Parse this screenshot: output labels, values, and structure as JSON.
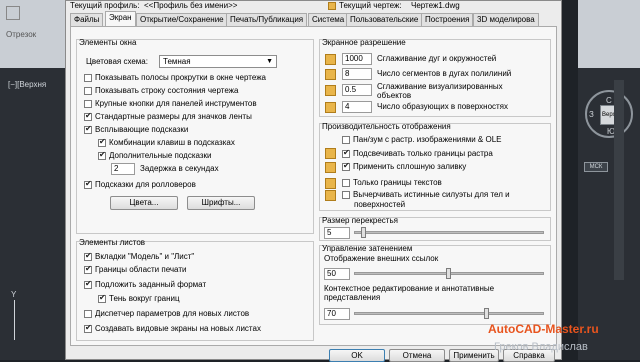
{
  "background": {
    "cad_left_text": "Отрезок",
    "viewport_label": "[−][Верхня",
    "viewcube_top": "С",
    "viewcube_left": "З",
    "viewcube_center": "Верх",
    "viewcube_bottom": "Ю",
    "wcs_label": "МСК",
    "axis_label": "Y",
    "watermark_site": "AutoCAD-Master.ru",
    "watermark_author": "Греков Владислав"
  },
  "header": {
    "current_profile_label": "Текущий профиль:",
    "current_profile_value": "<<Профиль без имени>>",
    "current_drawing_label": "Текущий чертеж:",
    "current_drawing_value": "Чертеж1.dwg"
  },
  "tabs": [
    "Файлы",
    "Экран",
    "Открытие/Сохранение",
    "Печать/Публикация",
    "Система",
    "Пользовательские",
    "Построения",
    "3D моделирова"
  ],
  "window_elements": {
    "title": "Элементы окна",
    "color_scheme_label": "Цветовая схема:",
    "color_scheme_value": "Темная",
    "checkboxes": [
      {
        "label": "Показывать полосы прокрутки в окне чертежа",
        "checked": false
      },
      {
        "label": "Показывать строку состояния чертежа",
        "checked": false
      },
      {
        "label": "Крупные кнопки для панелей инструментов",
        "checked": false
      },
      {
        "label": "Стандартные размеры для значков ленты",
        "checked": true
      },
      {
        "label": "Всплывающие подсказки",
        "checked": true
      },
      {
        "label": "Комбинации клавиш в подсказках",
        "checked": true
      },
      {
        "label": "Дополнительные подсказки",
        "checked": true
      }
    ],
    "delay_value": "2",
    "delay_label": "Задержка в секундах",
    "rollover_label": "Подсказки для ролловеров",
    "rollover_checked": true,
    "colors_button": "Цвета...",
    "fonts_button": "Шрифты..."
  },
  "layout_elements": {
    "title": "Элементы листов",
    "checkboxes": [
      {
        "label": "Вкладки \"Модель\" и \"Лист\"",
        "checked": true
      },
      {
        "label": "Границы области печати",
        "checked": true
      },
      {
        "label": "Подложить заданный формат",
        "checked": true
      },
      {
        "label": "Тень вокруг границ",
        "checked": true
      },
      {
        "label": "Диспетчер параметров для новых листов",
        "checked": false
      },
      {
        "label": "Создавать видовые экраны на новых листах",
        "checked": true
      }
    ]
  },
  "display_resolution": {
    "title": "Экранное разрешение",
    "rows": [
      {
        "value": "1000",
        "label": "Сглаживание дуг и окружностей"
      },
      {
        "value": "8",
        "label": "Число сегментов в дугах полилиний"
      },
      {
        "value": "0.5",
        "label": "Сглаживание визуализированных"
      },
      {
        "value": "4",
        "label": "Число образующих в поверхностях"
      }
    ],
    "row3_label_line2": "объектов"
  },
  "display_performance": {
    "title": "Производительность отображения",
    "checkboxes": [
      {
        "label": "Пан/зум с растр. изображениями & OLE",
        "checked": false
      },
      {
        "label": "Подсвечивать только границы растра",
        "checked": true
      },
      {
        "label": "Применить сплошную заливку",
        "checked": true
      },
      {
        "label": "Только границы текстов",
        "checked": false
      },
      {
        "label": "Вычерчивать истинные силуэты для тел и",
        "checked": false
      }
    ],
    "last_line2": "поверхностей"
  },
  "crosshair": {
    "title": "Размер перекрестья",
    "value": "5",
    "slider_fraction": 0.05
  },
  "fade": {
    "title": "Управление затенением",
    "xref_label": "Отображение внешних ссылок",
    "xref_value": "50",
    "xref_fraction": 0.5,
    "inplace_label_1": "Контекстное редактирование и аннотативные",
    "inplace_label_2": "представления",
    "inplace_value": "70",
    "inplace_fraction": 0.7
  },
  "buttons": {
    "ok": "OK",
    "cancel": "Отмена",
    "apply": "Применить",
    "help": "Справка"
  }
}
